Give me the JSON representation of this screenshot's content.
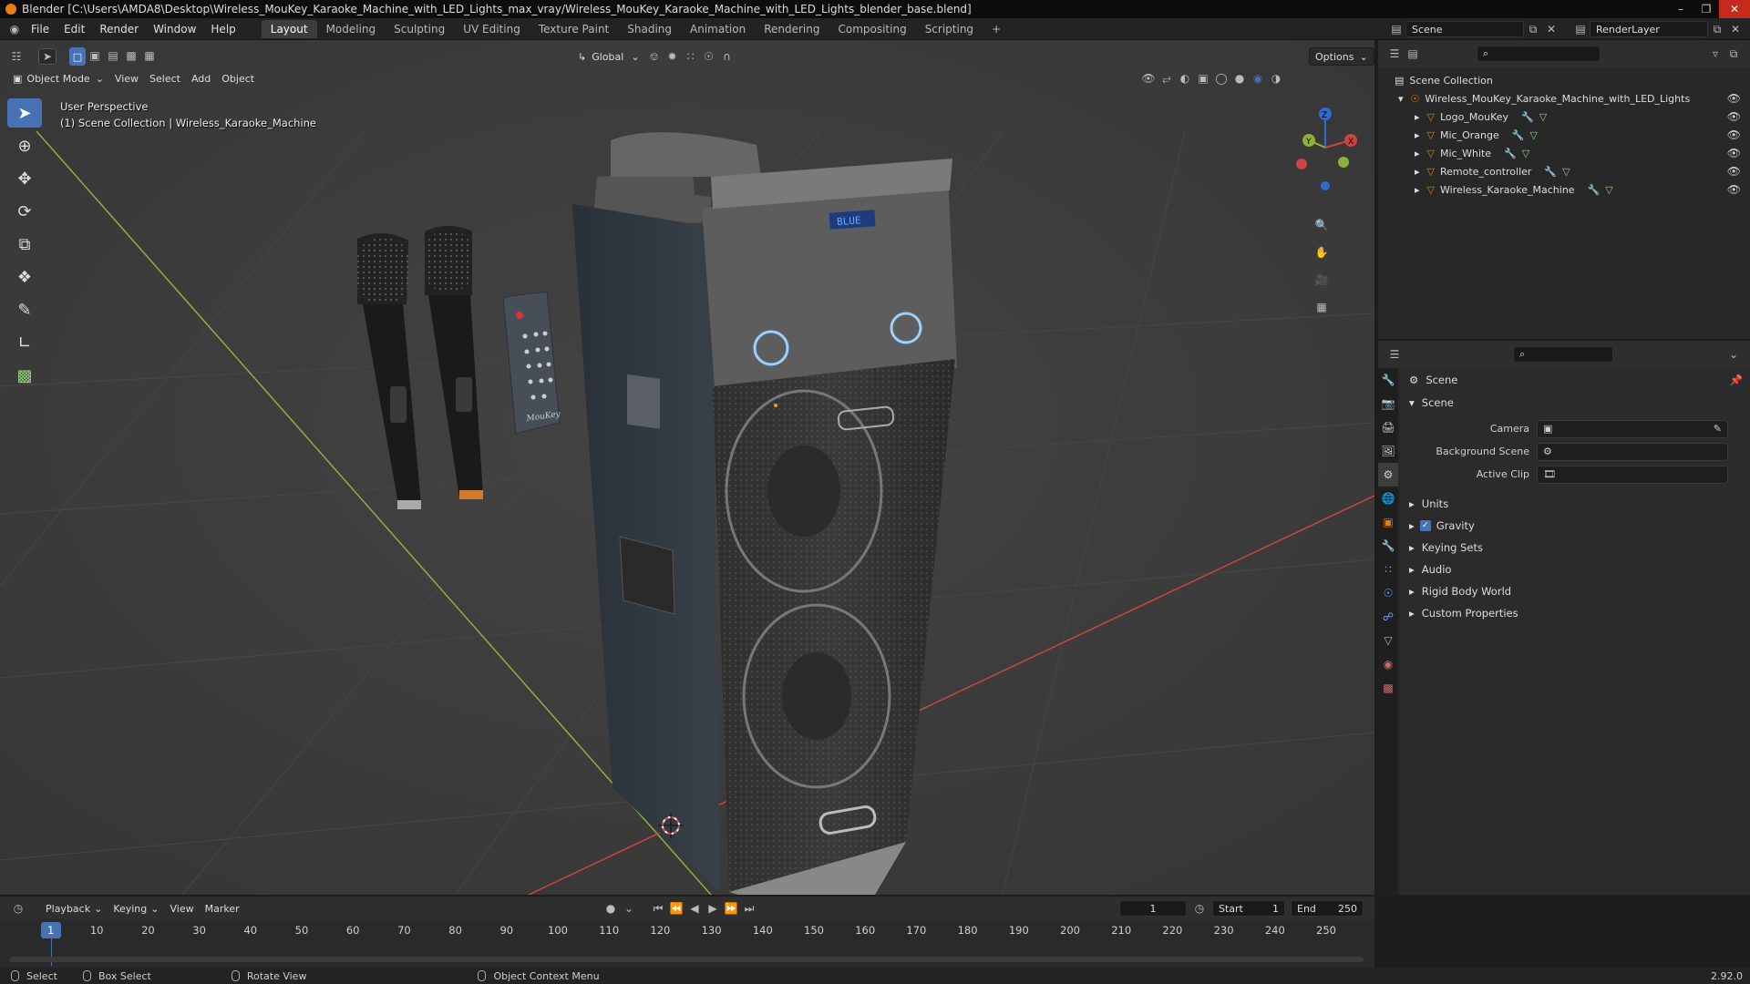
{
  "window": {
    "title": "Blender [C:\\Users\\AMDA8\\Desktop\\Wireless_MouKey_Karaoke_Machine_with_LED_Lights_max_vray/Wireless_MouKey_Karaoke_Machine_with_LED_Lights_blender_base.blend]"
  },
  "menu": {
    "items": [
      "File",
      "Edit",
      "Render",
      "Window",
      "Help"
    ],
    "workspaces": [
      "Layout",
      "Modeling",
      "Sculpting",
      "UV Editing",
      "Texture Paint",
      "Shading",
      "Animation",
      "Rendering",
      "Compositing",
      "Scripting"
    ],
    "active_workspace": "Layout",
    "add_tab": "+",
    "scene": "Scene",
    "render_layer": "RenderLayer"
  },
  "viewport": {
    "mode": "Object Mode",
    "menus": [
      "View",
      "Select",
      "Add",
      "Object"
    ],
    "transform_orientation": "Global",
    "options_label": "Options",
    "perspective_label": "User Perspective",
    "collection_label": "(1) Scene Collection | Wireless_Karaoke_Machine",
    "remote_brand": "MouKey",
    "display_text": "BLUE",
    "gizmo_axes": {
      "x": "X",
      "y": "Y",
      "z": "Z"
    },
    "tools": [
      "select-box-icon",
      "cursor-icon",
      "move-icon",
      "rotate-icon",
      "scale-icon",
      "transform-icon",
      "annotate-icon",
      "measure-icon",
      "add-cube-icon"
    ],
    "colors": {
      "x_axis": "#c8463f",
      "y_axis": "#8fb03a",
      "selection": "#4772b3",
      "outline_orange": "#e87d0d"
    }
  },
  "outliner": {
    "root": "Scene Collection",
    "collection": "Wireless_MouKey_Karaoke_Machine_with_LED_Lights",
    "objects": [
      "Logo_MouKey",
      "Mic_Orange",
      "Mic_White",
      "Remote_controller",
      "Wireless_Karaoke_Machine"
    ]
  },
  "properties": {
    "header": "Scene",
    "section": "Scene",
    "fields": [
      {
        "label": "Camera",
        "value": ""
      },
      {
        "label": "Background Scene",
        "value": ""
      },
      {
        "label": "Active Clip",
        "value": ""
      }
    ],
    "panels": [
      "Units",
      "Gravity",
      "Keying Sets",
      "Audio",
      "Rigid Body World",
      "Custom Properties"
    ],
    "gravity_checked": true
  },
  "timeline": {
    "menus": [
      "Playback",
      "Keying",
      "View",
      "Marker"
    ],
    "current_frame": "1",
    "start_label": "Start",
    "start": "1",
    "end_label": "End",
    "end": "250",
    "ticks": [
      "10",
      "20",
      "30",
      "40",
      "50",
      "60",
      "70",
      "80",
      "90",
      "100",
      "110",
      "120",
      "130",
      "140",
      "150",
      "160",
      "170",
      "180",
      "190",
      "200",
      "210",
      "220",
      "230",
      "240",
      "250"
    ],
    "playhead": "1"
  },
  "statusbar": {
    "select": "Select",
    "box_select": "Box Select",
    "rotate_view": "Rotate View",
    "context_menu": "Object Context Menu",
    "version": "2.92.0"
  }
}
